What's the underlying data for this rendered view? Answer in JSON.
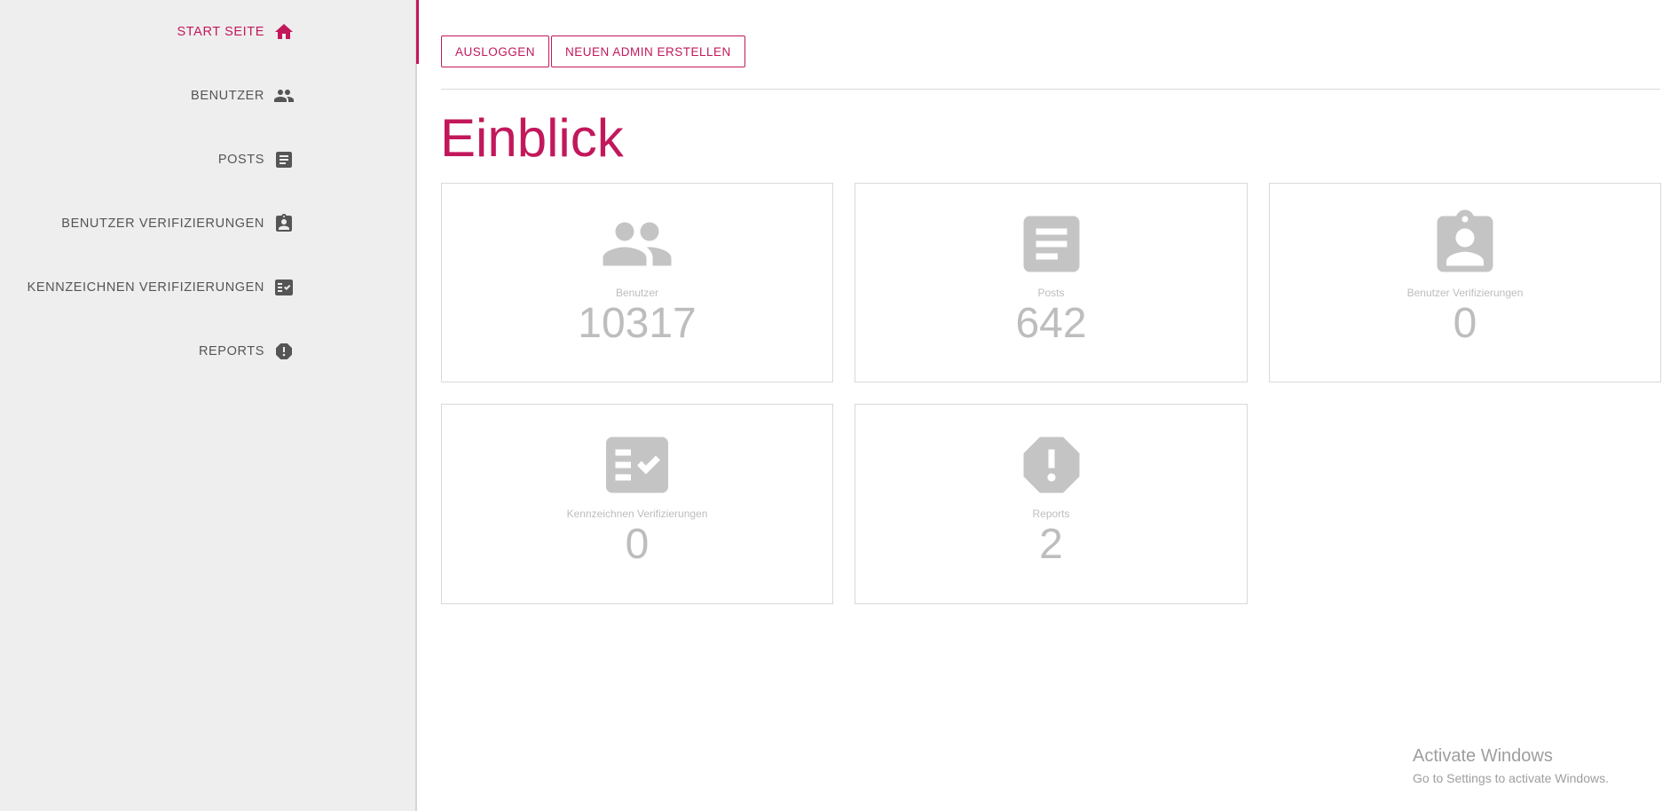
{
  "sidebar": {
    "items": [
      {
        "label": "START SEITE",
        "icon": "home-icon",
        "active": true
      },
      {
        "label": "BENUTZER",
        "icon": "people-icon",
        "active": false
      },
      {
        "label": "POSTS",
        "icon": "article-icon",
        "active": false
      },
      {
        "label": "BENUTZER VERIFIZIERUNGEN",
        "icon": "assignment-ind-icon",
        "active": false
      },
      {
        "label": "KENNZEICHNEN VERIFIZIERUNGEN",
        "icon": "fact-check-icon",
        "active": false
      },
      {
        "label": "REPORTS",
        "icon": "report-icon",
        "active": false
      }
    ]
  },
  "toolbar": {
    "logout_label": "AUSLOGGEN",
    "create_admin_label": "NEUEN ADMIN ERSTELLEN"
  },
  "main": {
    "title": "Einblick",
    "cards": [
      {
        "label": "Benutzer",
        "value": "10317",
        "icon": "people-icon"
      },
      {
        "label": "Posts",
        "value": "642",
        "icon": "article-icon"
      },
      {
        "label": "Benutzer Verifizierungen",
        "value": "0",
        "icon": "assignment-ind-icon"
      },
      {
        "label": "Kennzeichnen Verifizierungen",
        "value": "0",
        "icon": "fact-check-icon"
      },
      {
        "label": "Reports",
        "value": "2",
        "icon": "report-icon"
      }
    ]
  },
  "watermark": {
    "line1": "Activate Windows",
    "line2": "Go to Settings to activate Windows."
  },
  "colors": {
    "accent": "#c2185b",
    "sidebar_bg": "#eeeeee",
    "muted": "#bdbdbd",
    "icon_gray": "#c4c4c4",
    "nav_text": "#555555"
  }
}
